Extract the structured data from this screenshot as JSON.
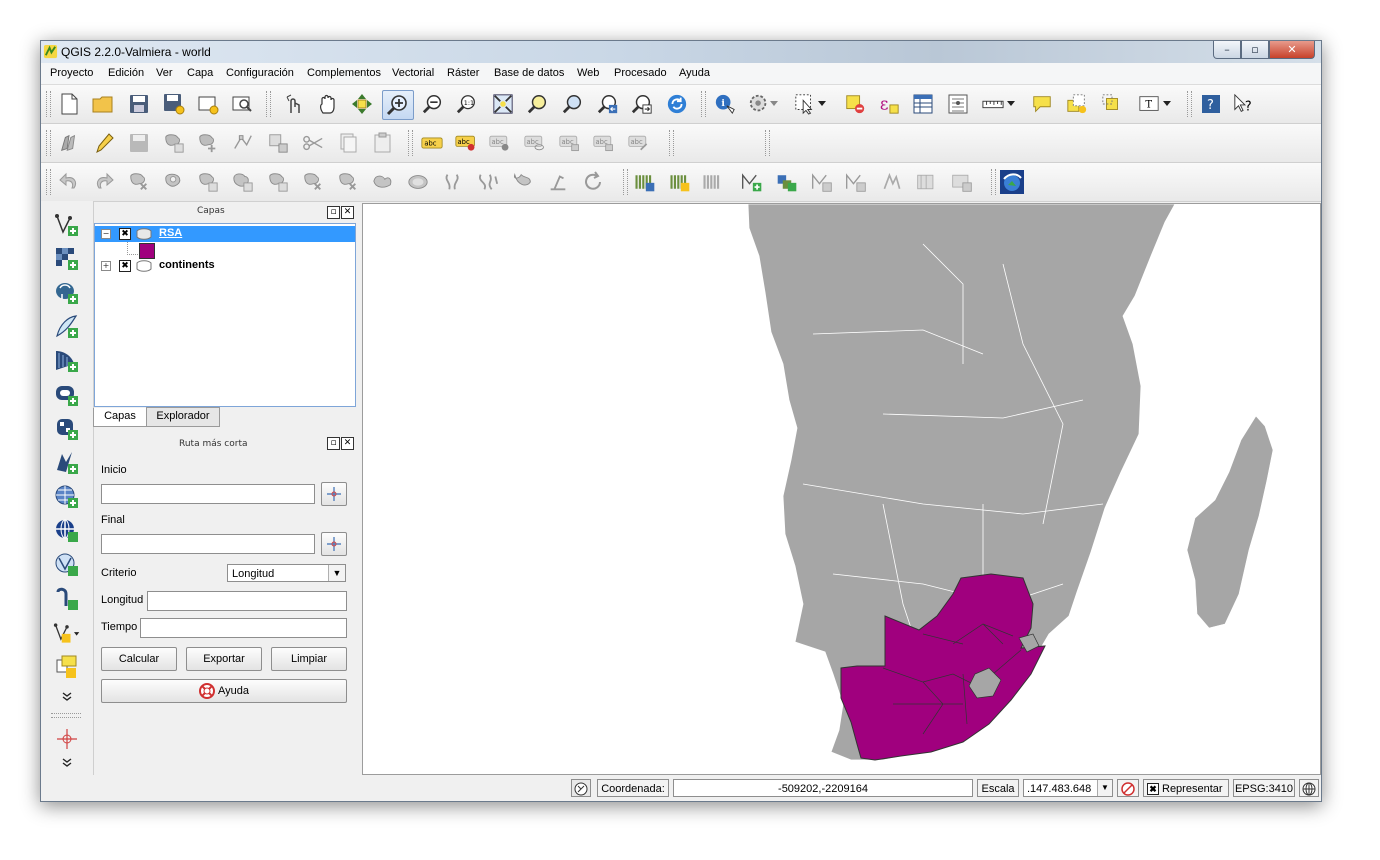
{
  "window": {
    "title": "QGIS 2.2.0-Valmiera - world",
    "controls": {
      "minimize": "–",
      "maximize": "▫",
      "close": "✕"
    }
  },
  "menu": {
    "items": [
      "Proyecto",
      "Edición",
      "Ver",
      "Capa",
      "Configuración",
      "Complementos",
      "Vectorial",
      "Ráster",
      "Base de datos",
      "Web",
      "Procesado",
      "Ayuda"
    ]
  },
  "layers_panel": {
    "title": "Capas",
    "layers": [
      {
        "name": "RSA",
        "checked": true,
        "expanded": true,
        "selected": true,
        "legend_color": "#a0007e"
      },
      {
        "name": "continents",
        "checked": true,
        "expanded": false,
        "selected": false
      }
    ],
    "tabs": [
      "Capas",
      "Explorador"
    ],
    "active_tab": "Capas"
  },
  "route_panel": {
    "title": "Ruta más corta",
    "start_label": "Inicio",
    "start_value": "",
    "end_label": "Final",
    "end_value": "",
    "criterion_label": "Criterio",
    "criterion_value": "Longitud",
    "length_label": "Longitud",
    "length_value": "",
    "time_label": "Tiempo",
    "time_value": "",
    "calculate_label": "Calcular",
    "export_label": "Exportar",
    "clear_label": "Limpiar",
    "help_label": "Ayuda"
  },
  "map": {
    "land_color": "#a6a6a6",
    "highlight_color": "#a0007e",
    "border_color": "#ffffff"
  },
  "statusbar": {
    "coordinate_label": "Coordenada:",
    "coordinate_value": "-509202,-2209164",
    "scale_label": "Escala",
    "scale_value": ".147.483.648",
    "render_label": "Representar",
    "render_checked": true,
    "crs": "EPSG:3410"
  },
  "icons": {
    "toolbar1": [
      "new-project-icon",
      "open-project-icon",
      "save-project-icon",
      "save-as-icon",
      "new-print-composer-icon",
      "composer-manager-icon",
      "touch-zoom-icon",
      "pan-icon",
      "pan-to-selection-icon",
      "zoom-in-icon",
      "zoom-out-icon",
      "zoom-actual-size-icon",
      "zoom-full-icon",
      "zoom-to-selection-icon",
      "zoom-to-layer-icon",
      "zoom-last-icon",
      "zoom-next-icon",
      "refresh-icon",
      "identify-icon",
      "action-icon",
      "select-icon",
      "deselect-icon",
      "field-calculator-icon",
      "attribute-table-icon",
      "statistics-icon",
      "measure-icon",
      "map-tips-icon",
      "new-bookmark-icon",
      "show-bookmarks-icon",
      "text-annotation-icon",
      "help-icon",
      "whats-this-icon"
    ],
    "toolbar2": [
      "current-edits-icon",
      "toggle-editing-icon",
      "save-edits-icon",
      "add-feature-icon",
      "move-feature-icon",
      "node-tool-icon",
      "delete-selected-icon",
      "cut-features-icon",
      "copy-features-icon",
      "paste-features-icon",
      "label-icon",
      "pin-labels-icon",
      "show-hide-labels-icon",
      "move-label-icon",
      "rotate-label-icon",
      "change-label-icon"
    ],
    "toolbar3": [
      "undo-icon",
      "redo-icon",
      "simplify-feature-icon",
      "add-ring-icon",
      "add-part-icon",
      "fill-ring-icon",
      "delete-ring-icon",
      "delete-part-icon",
      "reshape-icon",
      "offset-curve-icon",
      "split-features-icon",
      "split-parts-icon",
      "merge-selected-icon",
      "merge-attributes-icon",
      "rotate-point-symbols-icon",
      "rotate-feature-icon",
      "raster-histogram-icon",
      "raster-stretch-icon",
      "raster-increase-icon",
      "vector-new-icon",
      "vector-add-icon",
      "vector-edit-icon",
      "vector-filter-icon",
      "vector-tools-icon",
      "attribute-form-icon",
      "openlayers-icon",
      "google-earth-icon"
    ],
    "left": [
      "add-vector-layer-icon",
      "add-raster-layer-icon",
      "add-postgis-layer-icon",
      "add-spatialite-layer-icon",
      "add-mssql-layer-icon",
      "add-oracle-layer-icon",
      "add-wms-layer-icon",
      "add-wcs-layer-icon",
      "add-wfs-layer-icon",
      "add-delimited-text-icon",
      "add-virtual-layer-icon",
      "new-shapefile-icon",
      "new-spatialite-icon",
      "more-tools-icon",
      "coordinate-capture-icon",
      "more-tools-icon-2"
    ]
  }
}
